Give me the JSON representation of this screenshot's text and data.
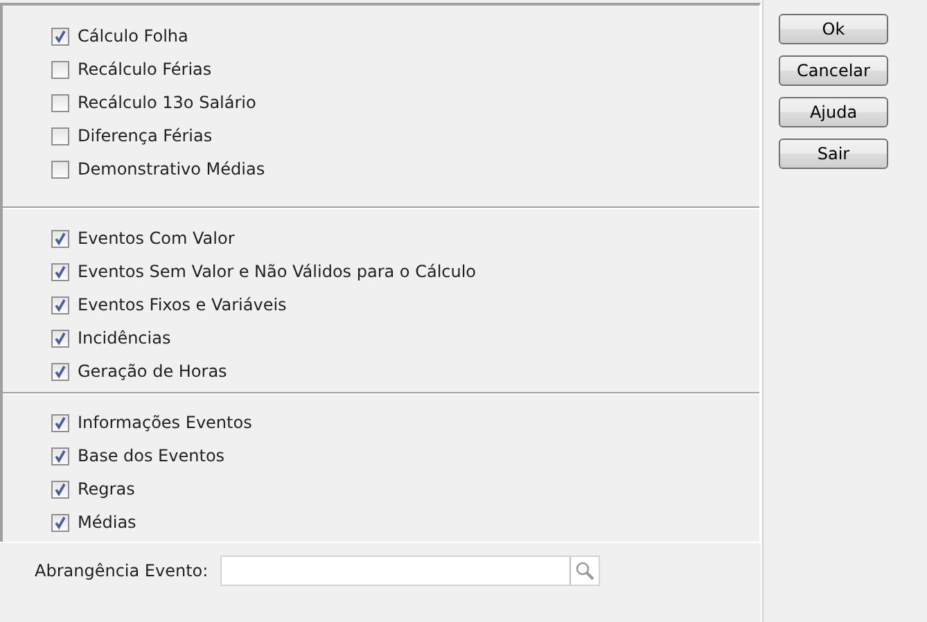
{
  "option_groups": [
    {
      "options": [
        {
          "label": "Cálculo Folha",
          "checked": true
        },
        {
          "label": "Recálculo Férias",
          "checked": false
        },
        {
          "label": "Recálculo 13o Salário",
          "checked": false
        },
        {
          "label": "Diferença Férias",
          "checked": false
        },
        {
          "label": "Demonstrativo Médias",
          "checked": false
        }
      ]
    },
    {
      "options": [
        {
          "label": "Eventos Com Valor",
          "checked": true
        },
        {
          "label": "Eventos Sem Valor e Não Válidos para o Cálculo",
          "checked": true
        },
        {
          "label": "Eventos Fixos e Variáveis",
          "checked": true
        },
        {
          "label": "Incidências",
          "checked": true
        },
        {
          "label": "Geração de Horas",
          "checked": true
        }
      ]
    },
    {
      "options": [
        {
          "label": "Informações Eventos",
          "checked": true
        },
        {
          "label": "Base dos Eventos",
          "checked": true
        },
        {
          "label": "Regras",
          "checked": true
        },
        {
          "label": "Médias",
          "checked": true
        }
      ]
    }
  ],
  "event_scope": {
    "label": "Abrangência Evento:"
  },
  "buttons": [
    {
      "label": "Ok"
    },
    {
      "label": "Cancelar"
    },
    {
      "label": "Ajuda"
    },
    {
      "label": "Sair"
    }
  ]
}
